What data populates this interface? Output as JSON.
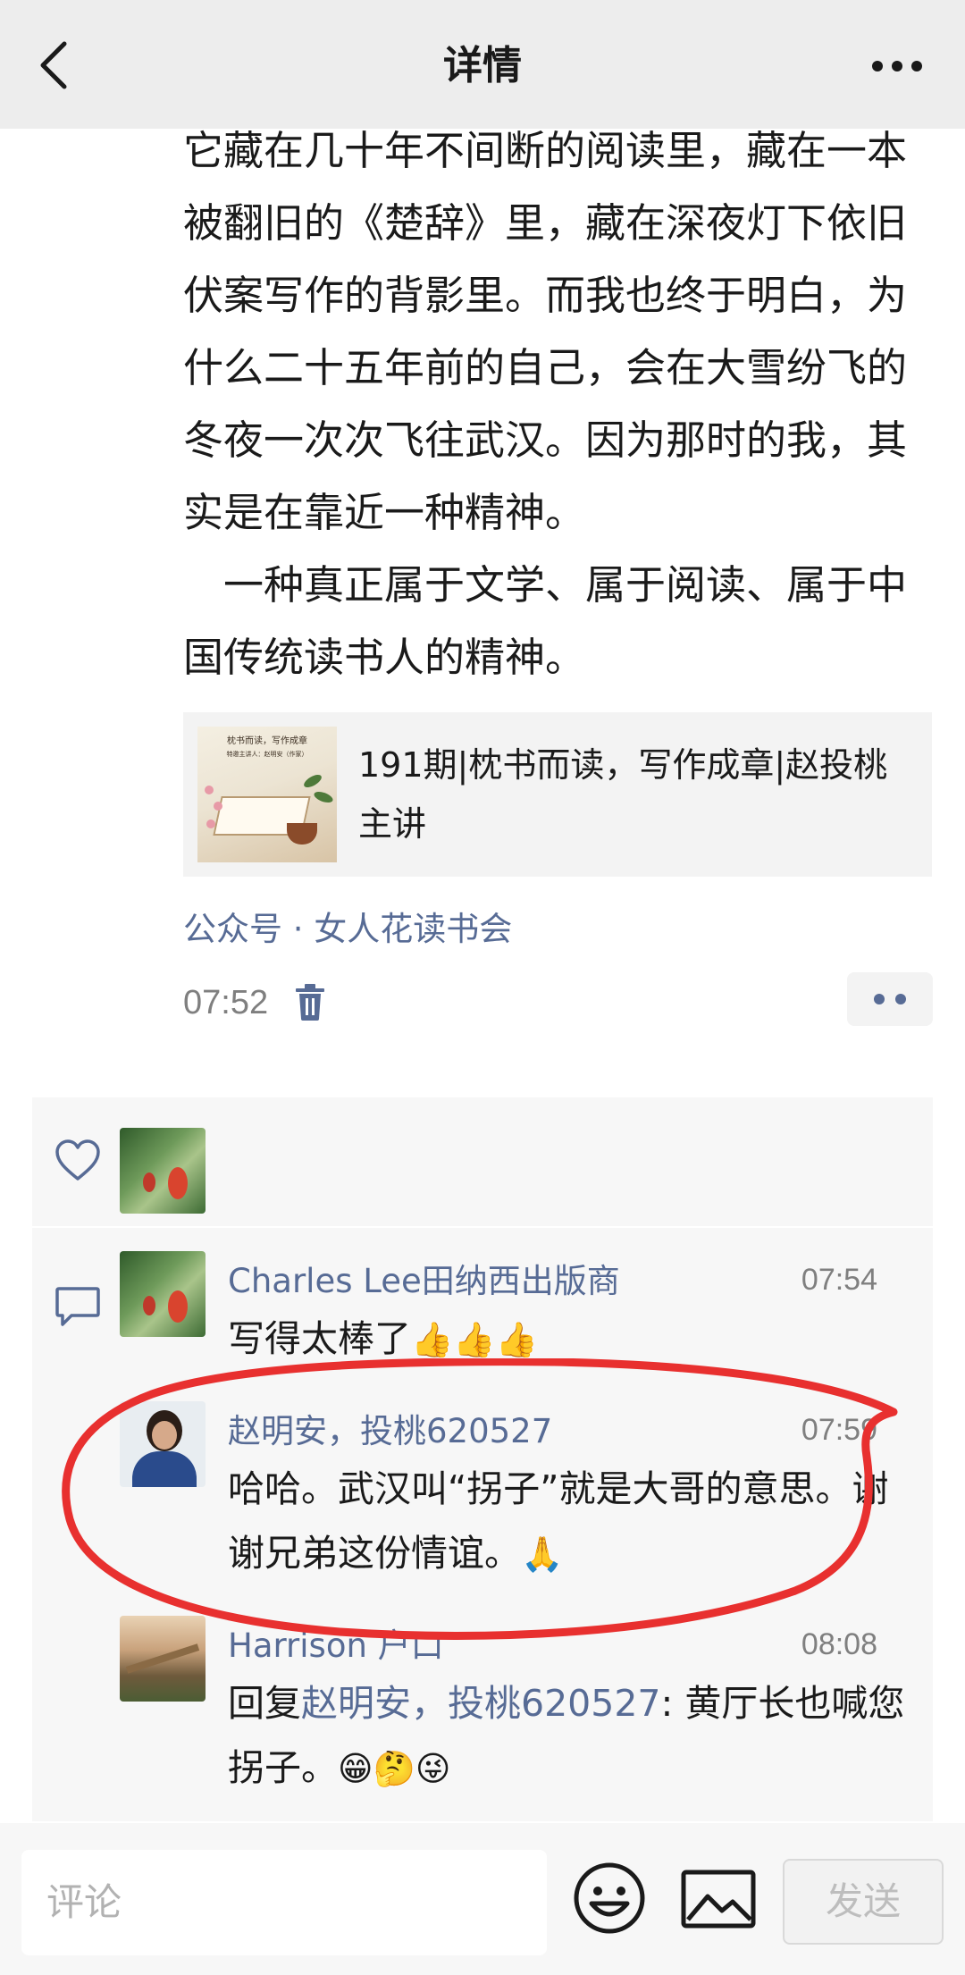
{
  "header": {
    "title": "详情",
    "back_icon": "chevron-left-icon",
    "more_icon": "more-dots-icon"
  },
  "article": {
    "paragraphs": [
      "它藏在几十年不间断的阅读里，藏在一本被翻旧的《楚辞》里，藏在深夜灯下依旧伏案写作的背影里。而我也终于明白，为什么二十五年前的自己，会在大雪纷飞的冬夜一次次飞往武汉。因为那时的我，其实是在靠近一种精神。",
      "　一种真正属于文学、属于阅读、属于中国传统读书人的精神。"
    ]
  },
  "link_card": {
    "title": "191期|枕书而读，写作成章|赵投桃主讲",
    "thumb_title": "枕书而读，写作成章",
    "thumb_subtitle": "特邀主讲人：赵明安（作家）"
  },
  "post_meta": {
    "source": "公众号 · 女人花读书会",
    "time": "07:52"
  },
  "likes": {
    "icon": "heart-outline-icon",
    "users": [
      "Charles Lee田纳西出版商"
    ]
  },
  "comments": [
    {
      "name": "Charles Lee田纳西出版商",
      "time": "07:54",
      "text": "写得太棒了",
      "emoji": "👍👍👍"
    },
    {
      "name": "赵明安，投桃620527",
      "time": "07:59",
      "text": "哈哈。武汉叫“拐子”就是大哥的意思。谢谢兄弟这份情谊。",
      "emoji": "🙏"
    },
    {
      "name": "Harrison 户口",
      "time": "08:08",
      "reply_prefix": "回复",
      "reply_to": "赵明安，投桃620527",
      "text": ": 黄厅长也喊您拐子。",
      "emoji": "😁🤔😜"
    }
  ],
  "bottom_bar": {
    "placeholder": "评论",
    "send_label": "发送"
  },
  "colors": {
    "link": "#576b95",
    "annotation_red": "#e8302f",
    "header_bg": "#ededed"
  }
}
